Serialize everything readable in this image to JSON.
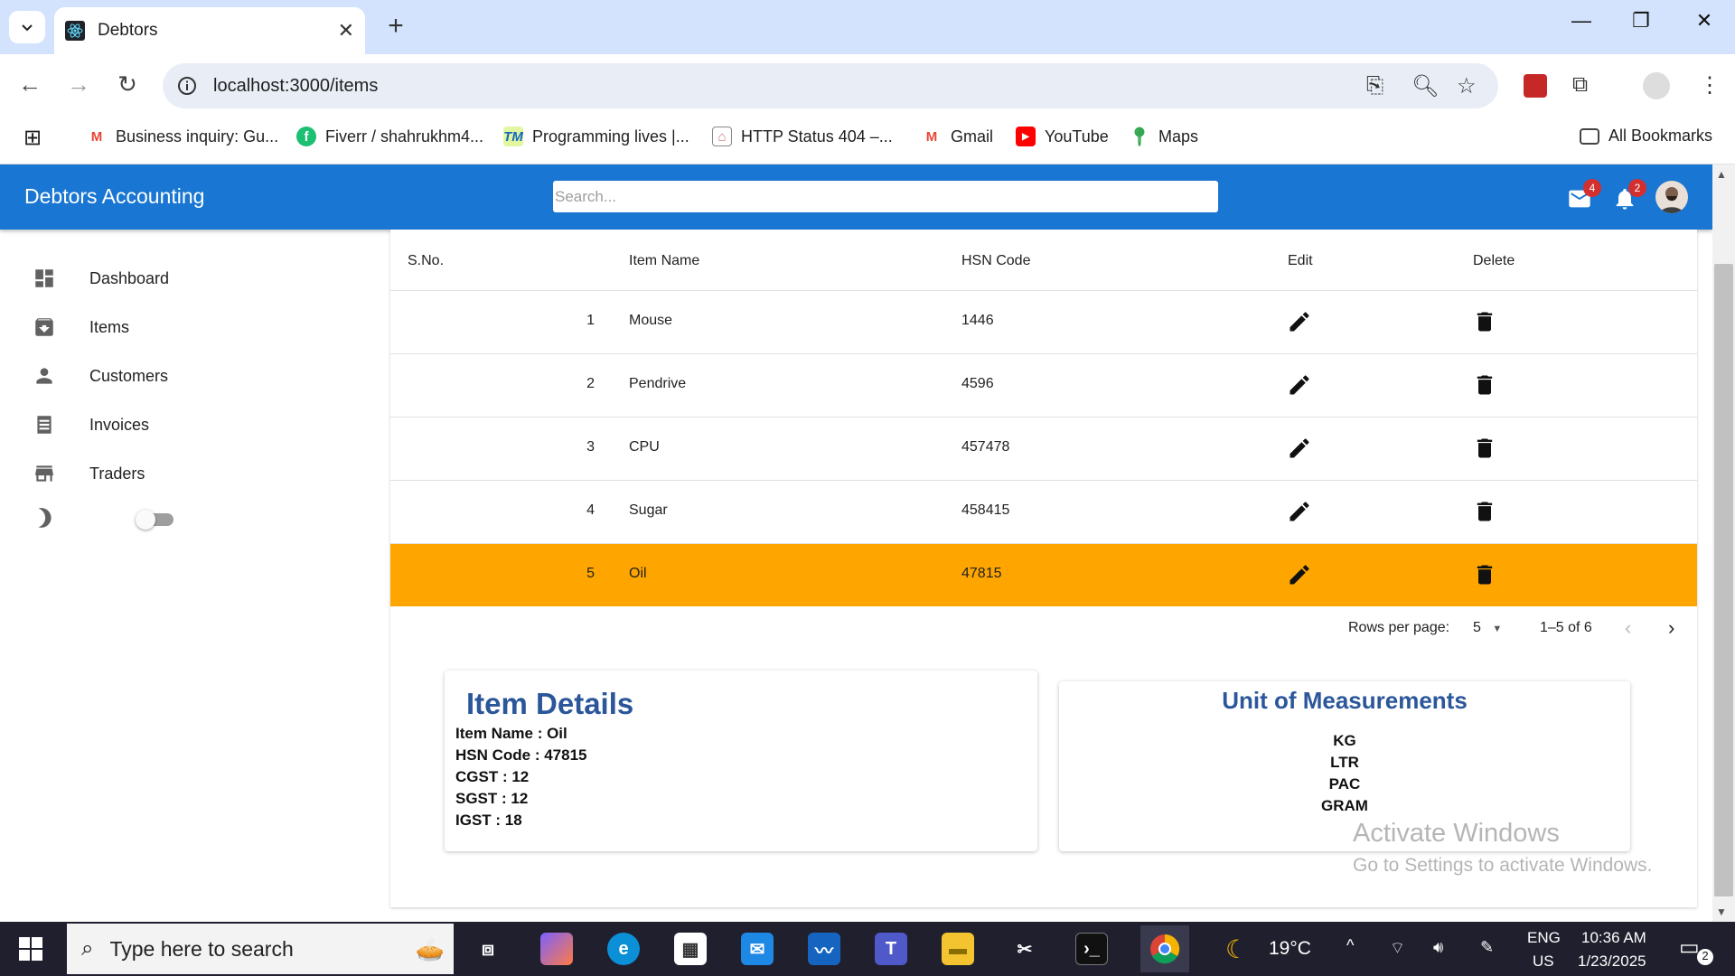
{
  "browser": {
    "tab_title": "Debtors",
    "url": "localhost:3000/items",
    "bookmarks": [
      {
        "label": "Business inquiry: Gu...",
        "icon": "gmail-icon"
      },
      {
        "label": "Fiverr / shahrukhm4...",
        "icon": "fiverr-icon"
      },
      {
        "label": "Programming lives |...",
        "icon": "tm-icon"
      },
      {
        "label": "HTTP Status 404 –...",
        "icon": "tomcat-icon"
      },
      {
        "label": "Gmail",
        "icon": "gmail-icon"
      },
      {
        "label": "YouTube",
        "icon": "youtube-icon"
      },
      {
        "label": "Maps",
        "icon": "maps-icon"
      }
    ],
    "all_bookmarks": "All Bookmarks"
  },
  "app": {
    "title": "Debtors Accounting",
    "search_placeholder": "Search...",
    "mail_badge": "4",
    "notif_badge": "2"
  },
  "sidebar": {
    "items": [
      {
        "label": "Dashboard",
        "icon": "dashboard-icon"
      },
      {
        "label": "Items",
        "icon": "archive-icon"
      },
      {
        "label": "Customers",
        "icon": "person-icon"
      },
      {
        "label": "Invoices",
        "icon": "receipt-icon"
      },
      {
        "label": "Traders",
        "icon": "store-icon"
      }
    ],
    "theme_toggle_icon": "moon-icon"
  },
  "table": {
    "headers": {
      "sno": "S.No.",
      "name": "Item Name",
      "hsn": "HSN Code",
      "edit": "Edit",
      "delete": "Delete"
    },
    "rows": [
      {
        "sno": "1",
        "name": "Mouse",
        "hsn": "1446"
      },
      {
        "sno": "2",
        "name": "Pendrive",
        "hsn": "4596"
      },
      {
        "sno": "3",
        "name": "CPU",
        "hsn": "457478"
      },
      {
        "sno": "4",
        "name": "Sugar",
        "hsn": "458415"
      },
      {
        "sno": "5",
        "name": "Oil",
        "hsn": "47815"
      }
    ],
    "selected_row": 5,
    "selected_color": "#ffa500"
  },
  "pagination": {
    "rows_per_page_label": "Rows per page:",
    "rows_per_page_value": "5",
    "range": "1–5 of 6"
  },
  "item_details": {
    "title": "Item Details",
    "lines": [
      "Item Name : Oil",
      "HSN Code : 47815",
      "CGST : 12",
      "SGST : 12",
      "IGST : 18"
    ]
  },
  "uom": {
    "title": "Unit of Measurements",
    "units": [
      "KG",
      "LTR",
      "PAC",
      "GRAM"
    ]
  },
  "watermark": {
    "line1": "Activate Windows",
    "line2": "Go to Settings to activate Windows."
  },
  "taskbar": {
    "search_placeholder": "Type here to search",
    "temperature": "19°C",
    "lang1": "ENG",
    "lang2": "US",
    "time": "10:36 AM",
    "date": "1/23/2025",
    "notifications": "2"
  },
  "colors": {
    "appbar": "#1976d2",
    "title_blue": "#2b579a",
    "badge": "#d32f2f"
  }
}
